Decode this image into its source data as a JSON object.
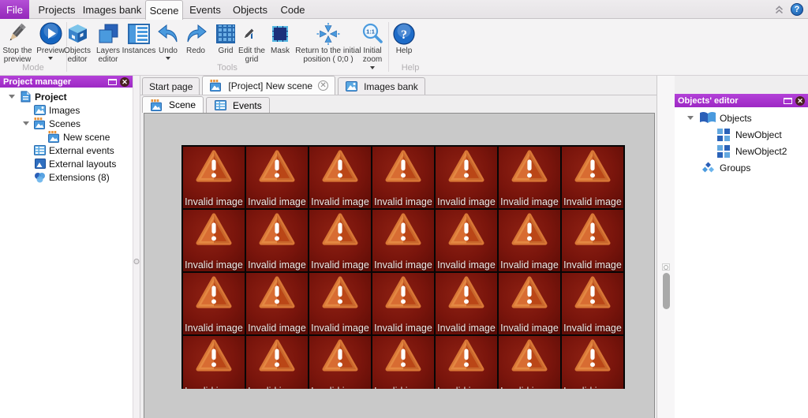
{
  "menubar": {
    "file_label": "File",
    "items": [
      "Projects",
      "Images bank",
      "Scene",
      "Events",
      "Objects",
      "Code"
    ],
    "active_item": "Scene"
  },
  "ribbon": {
    "group_labels": [
      "Mode",
      "Tools",
      "Help"
    ],
    "buttons": [
      "Stop the preview",
      "Preview",
      "Objects editor",
      "Layers editor",
      "Instances",
      "Undo",
      "Redo",
      "Grid",
      "Edit the grid",
      "Mask",
      "Return to the initial position ( 0;0 )",
      "Initial zoom",
      "Help"
    ]
  },
  "project_manager": {
    "title": "Project manager",
    "items": [
      {
        "label": "Project",
        "icon": "document-icon",
        "level": 0,
        "expanded": true,
        "bold": true
      },
      {
        "label": "Images",
        "icon": "image-icon",
        "level": 1
      },
      {
        "label": "Scenes",
        "icon": "scene-icon",
        "level": 1,
        "expanded": true
      },
      {
        "label": "New scene",
        "icon": "scene-icon",
        "level": 2
      },
      {
        "label": "External events",
        "icon": "events-icon",
        "level": 1
      },
      {
        "label": "External layouts",
        "icon": "layout-icon",
        "level": 1
      },
      {
        "label": "Extensions (8)",
        "icon": "extensions-icon",
        "level": 1
      }
    ]
  },
  "doc_tabs": [
    {
      "label": "Start page",
      "active": false
    },
    {
      "label": "[Project] New scene",
      "icon": "scene-icon",
      "closable": true,
      "active": true
    },
    {
      "label": "Images bank",
      "icon": "image-icon",
      "active": false
    }
  ],
  "sub_tabs": [
    {
      "label": "Scene",
      "icon": "scene-icon",
      "active": true
    },
    {
      "label": "Events",
      "icon": "events-icon",
      "active": false
    }
  ],
  "scene_canvas": {
    "invalid_label": "Invalid image",
    "columns": 7,
    "rows": 4
  },
  "objects_editor": {
    "title": "Objects' editor",
    "items": [
      {
        "label": "Objects",
        "icon": "book-icon",
        "level": 0,
        "expanded": true
      },
      {
        "label": "NewObject",
        "icon": "object-icon",
        "level": 1
      },
      {
        "label": "NewObject2",
        "icon": "object-icon",
        "level": 1
      },
      {
        "label": "Groups",
        "icon": "groups-icon",
        "level": 0
      }
    ]
  },
  "colors": {
    "header_purple": "#a733d1",
    "file_purple": "#9c2fc2",
    "tile_red": "#7a150c",
    "triangle_orange": "#c8501d"
  }
}
